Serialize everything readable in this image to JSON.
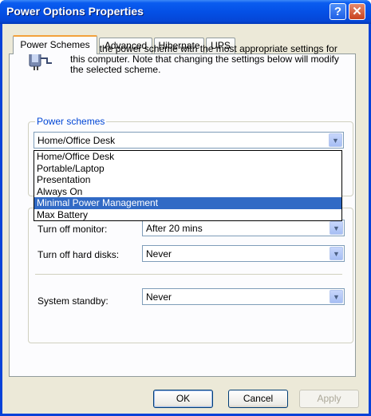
{
  "window": {
    "title": "Power Options Properties",
    "help_glyph": "?",
    "close_glyph": "✕"
  },
  "tabs": [
    {
      "label": "Power Schemes",
      "active": true
    },
    {
      "label": "Advanced",
      "active": false
    },
    {
      "label": "Hibernate",
      "active": false
    },
    {
      "label": "UPS",
      "active": false
    }
  ],
  "intro": {
    "text": "Select the power scheme with the most appropriate settings for this computer. Note that changing the settings below will modify the selected scheme."
  },
  "schemes": {
    "group_label": "Power schemes",
    "selected": "Home/Office Desk",
    "options": [
      "Home/Office Desk",
      "Portable/Laptop",
      "Presentation",
      "Always On",
      "Minimal Power Management",
      "Max Battery"
    ],
    "highlighted": "Minimal Power Management"
  },
  "settings": {
    "monitor": {
      "label": "Turn off monitor:",
      "value": "After 20 mins"
    },
    "hard_disks": {
      "label": "Turn off hard disks:",
      "value": "Never"
    },
    "standby": {
      "label": "System standby:",
      "value": "Never"
    }
  },
  "buttons": {
    "ok": "OK",
    "cancel": "Cancel",
    "apply": "Apply"
  },
  "colors": {
    "titlebar": "#0450e6",
    "dialog": "#ece9d8",
    "selection": "#316ac5",
    "group_label": "#0046d5"
  }
}
